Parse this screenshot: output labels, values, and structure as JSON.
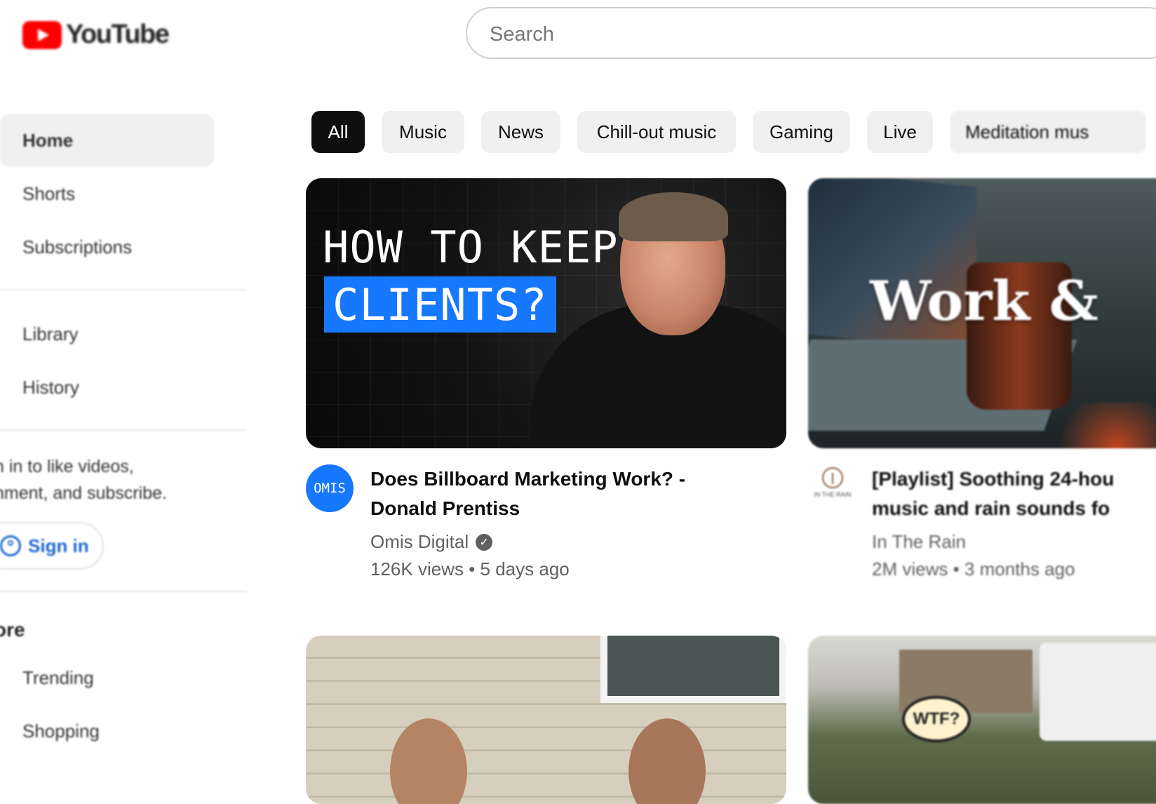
{
  "header": {
    "logo_text": "YouTube",
    "search_placeholder": "Search"
  },
  "sidebar": {
    "items": [
      {
        "label": "Home",
        "active": true
      },
      {
        "label": "Shorts"
      },
      {
        "label": "Subscriptions"
      },
      {
        "label": "Library"
      },
      {
        "label": "History"
      }
    ],
    "signin_prompt_line1": "n in to like videos,",
    "signin_prompt_line2": "nment, and subscribe.",
    "signin_button": "Sign in",
    "explore_heading": "ore",
    "explore_items": [
      {
        "label": "Trending"
      },
      {
        "label": "Shopping"
      }
    ]
  },
  "chips": [
    {
      "label": "All",
      "active": true
    },
    {
      "label": "Music"
    },
    {
      "label": "News"
    },
    {
      "label": "Chill-out music"
    },
    {
      "label": "Gaming"
    },
    {
      "label": "Live"
    },
    {
      "label": "Meditation mus"
    }
  ],
  "videos": [
    {
      "thumb_line1": "HOW TO KEEP",
      "thumb_line2": "CLIENTS?",
      "avatar_text": "OMIS",
      "title_line1": "Does Billboard Marketing Work? -",
      "title_line2": "Donald Prentiss",
      "channel": "Omis Digital",
      "verified": true,
      "views": "126K views",
      "age": "5 days ago"
    },
    {
      "thumb_text": "Work &",
      "avatar_text": "IN THE RAIN",
      "title_line1": "[Playlist] Soothing 24-hou",
      "title_line2": "music and rain sounds fo",
      "channel": "In The Rain",
      "views": "2M views",
      "age": "3 months ago"
    },
    {},
    {
      "thumb_bubble_text": "WTF?"
    }
  ],
  "colors": {
    "brand_red": "#ff0000",
    "accent_blue": "#1677ff",
    "link_blue": "#1a67d2",
    "chip_active_bg": "#0f0f0f",
    "chip_bg": "#f0f0f0"
  },
  "icons": [
    "youtube-logo-icon",
    "verified-check-icon",
    "user-circle-icon"
  ]
}
